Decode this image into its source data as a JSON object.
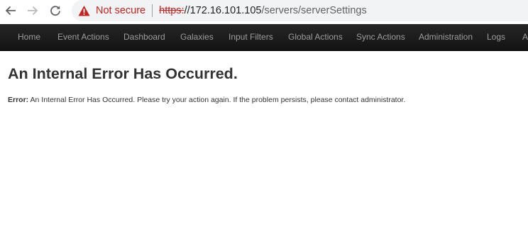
{
  "browser": {
    "security_label": "Not secure",
    "url_scheme": "https:",
    "url_host": "//172.16.101.105",
    "url_path": "/servers/serverSettings",
    "icons": {
      "back": "arrow-back-icon",
      "forward": "arrow-forward-icon",
      "reload": "reload-icon",
      "security": "warning-triangle-icon"
    },
    "colors": {
      "warning": "#c5221f",
      "omnibox_bg": "#f1f3f4"
    }
  },
  "navbar": {
    "items": [
      {
        "label": "Home"
      },
      {
        "label": "Event Actions"
      },
      {
        "label": "Dashboard"
      },
      {
        "label": "Galaxies"
      },
      {
        "label": "Input Filters"
      },
      {
        "label": "Global Actions"
      },
      {
        "label": "Sync Actions"
      },
      {
        "label": "Administration"
      },
      {
        "label": "Logs"
      },
      {
        "label": "A"
      }
    ],
    "colors": {
      "background": "#1b1b1b",
      "text": "#9d9d9d"
    }
  },
  "main": {
    "title": "An Internal Error Has Occurred.",
    "error_label": "Error:",
    "error_text": " An Internal Error Has Occurred. Please try your action again. If the problem persists, please contact administrator."
  }
}
